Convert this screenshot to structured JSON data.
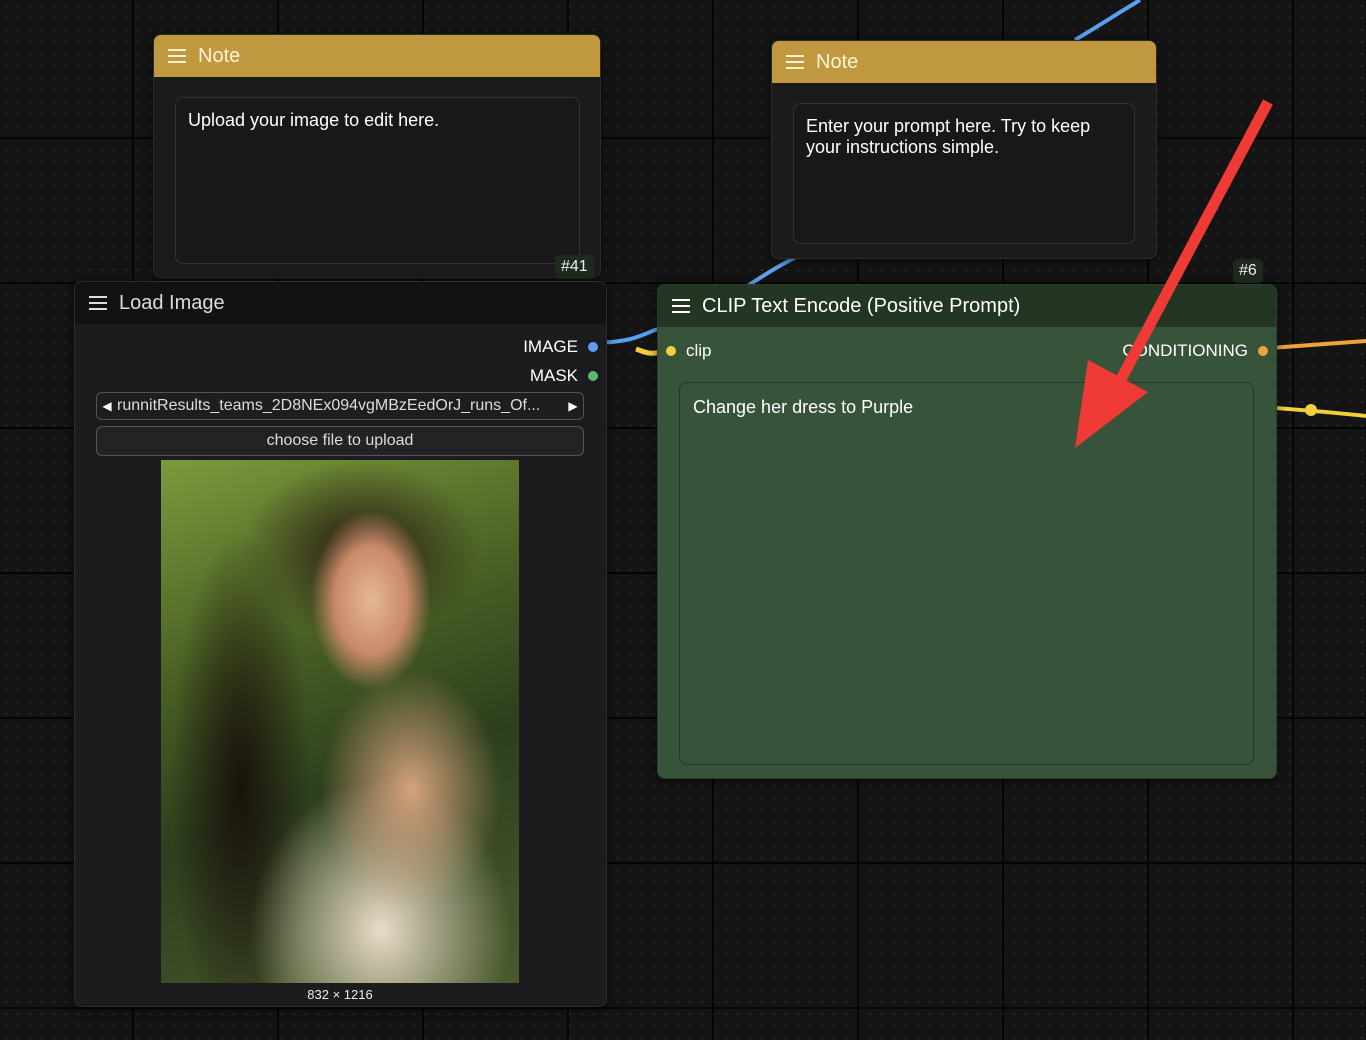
{
  "note_left": {
    "title": "Note",
    "text": "Upload your image to edit here.",
    "id": "#41"
  },
  "note_right": {
    "title": "Note",
    "text": "Enter your prompt here.  Try to keep your instructions simple."
  },
  "load_image": {
    "title": "Load Image",
    "outputs": {
      "image": "IMAGE",
      "mask": "MASK"
    },
    "file": "runnitResults_teams_2D8NEx094vgMBzEedOrJ_runs_Of...",
    "upload_label": "choose file to upload",
    "dimensions": "832 × 1216"
  },
  "clip_node": {
    "id": "#6",
    "title": "CLIP Text Encode (Positive Prompt)",
    "input": "clip",
    "output": "CONDITIONING",
    "prompt": "Change her dress to Purple"
  },
  "colors": {
    "note_header": "#c0983f",
    "clip_body": "#37533a",
    "clip_header": "#233523",
    "image_socket": "#5aa0f0",
    "mask_socket": "#5bb872",
    "clip_socket": "#f2d03c",
    "conditioning_socket": "#f0a23c",
    "arrow": "#f03a35"
  }
}
